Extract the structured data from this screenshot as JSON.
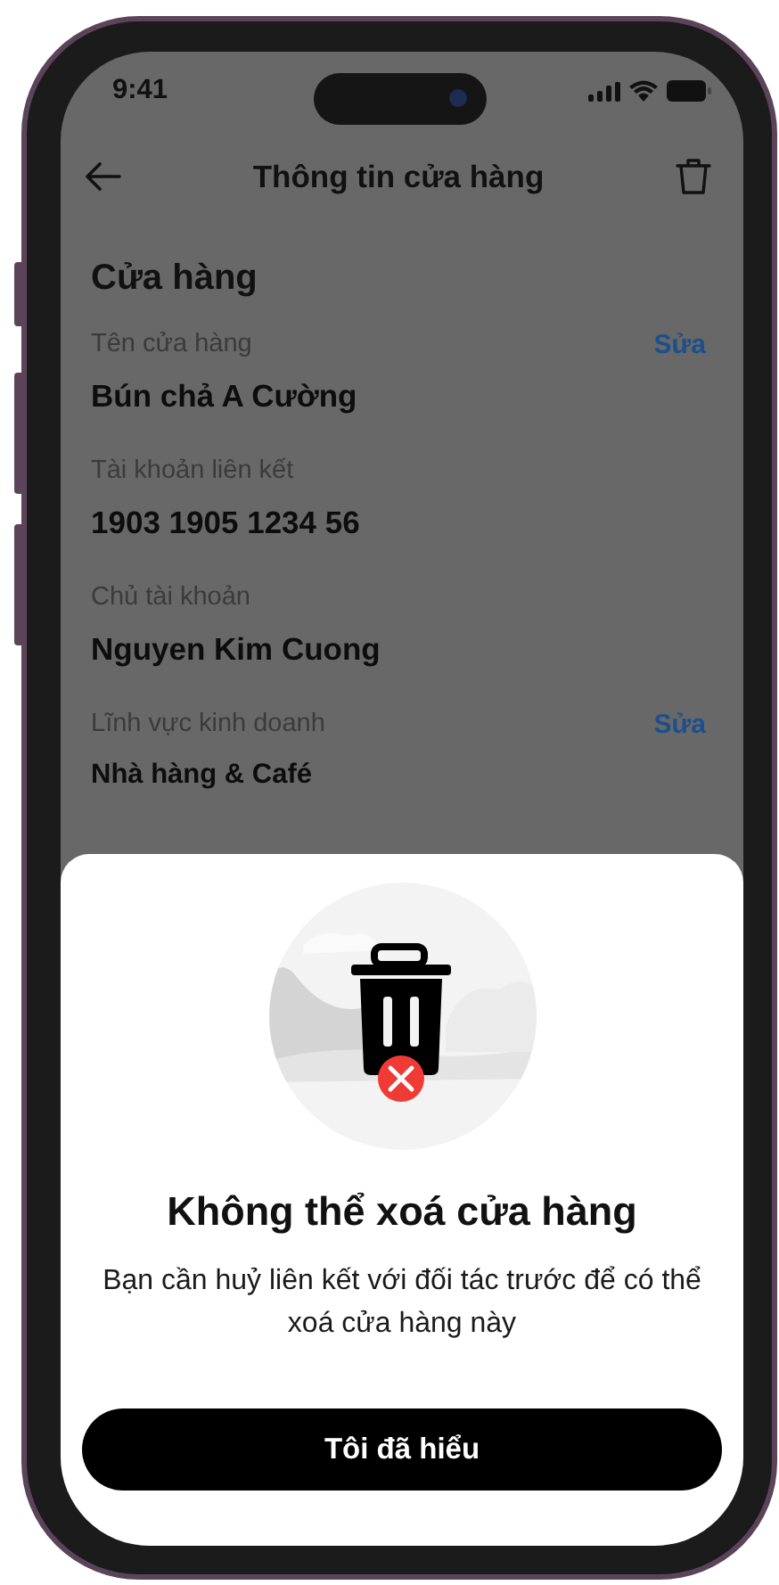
{
  "status_bar": {
    "time": "9:41"
  },
  "header": {
    "title": "Thông tin cửa hàng"
  },
  "section": {
    "title": "Cửa hàng"
  },
  "fields": [
    {
      "kind": "primary",
      "label": "Tên cửa hàng",
      "value": "Bún chả A Cường",
      "edit": "Sửa"
    },
    {
      "kind": "primary",
      "label": "Tài khoản liên kết",
      "value": "1903 1905 1234 56"
    },
    {
      "kind": "primary",
      "label": "Chủ tài khoản",
      "value": "Nguyen Kim Cuong"
    },
    {
      "kind": "secondary",
      "label": "Lĩnh vực kinh doanh",
      "value": "Nhà hàng & Café",
      "edit": "Sửa"
    }
  ],
  "dialog": {
    "title": "Không thể xoá cửa hàng",
    "message": "Bạn cần huỷ liên kết với đối tác trước để có thể xoá cửa hàng này",
    "button": "Tôi đã hiểu"
  }
}
